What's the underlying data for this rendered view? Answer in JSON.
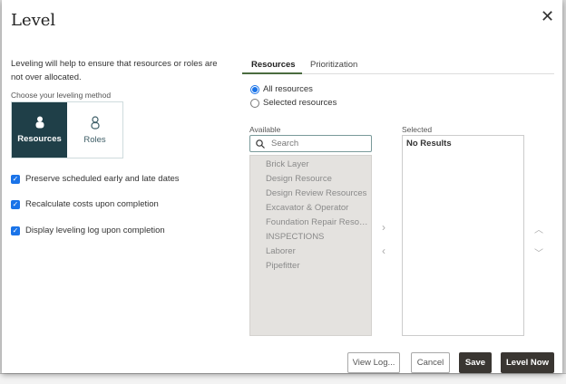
{
  "dialog": {
    "title": "Level",
    "close_icon": "close-icon",
    "description": "Leveling will help to ensure that resources or roles are not over allocated.",
    "method_label": "Choose your leveling method",
    "methods": [
      {
        "label": "Resources",
        "icon": "person-icon",
        "selected": true
      },
      {
        "label": "Roles",
        "icon": "person-outline-icon",
        "selected": false
      }
    ],
    "options": [
      {
        "label": "Preserve scheduled early and late dates",
        "checked": true
      },
      {
        "label": "Recalculate costs upon completion",
        "checked": true
      },
      {
        "label": "Display leveling log upon completion",
        "checked": true
      }
    ],
    "tabs": [
      {
        "label": "Resources",
        "active": true
      },
      {
        "label": "Prioritization",
        "active": false
      }
    ],
    "radios": [
      {
        "label": "All resources",
        "selected": true
      },
      {
        "label": "Selected resources",
        "selected": false
      }
    ],
    "available": {
      "label": "Available",
      "search_placeholder": "Search",
      "items": [
        "Brick Layer",
        "Design Resource",
        "Design Review Resources",
        "Excavator & Operator",
        "Foundation Repair Resources",
        "INSPECTIONS",
        "Laborer",
        "Pipefitter"
      ]
    },
    "selected": {
      "label": "Selected",
      "empty_text": "No Results"
    },
    "buttons": {
      "view_log": "View Log...",
      "cancel": "Cancel",
      "save": "Save",
      "level_now": "Level Now"
    },
    "colors": {
      "accent": "#1f3f48",
      "checkbox": "#1a73e8",
      "primary_button": "#3a3632",
      "tab_underline": "#4a6b3f"
    }
  }
}
